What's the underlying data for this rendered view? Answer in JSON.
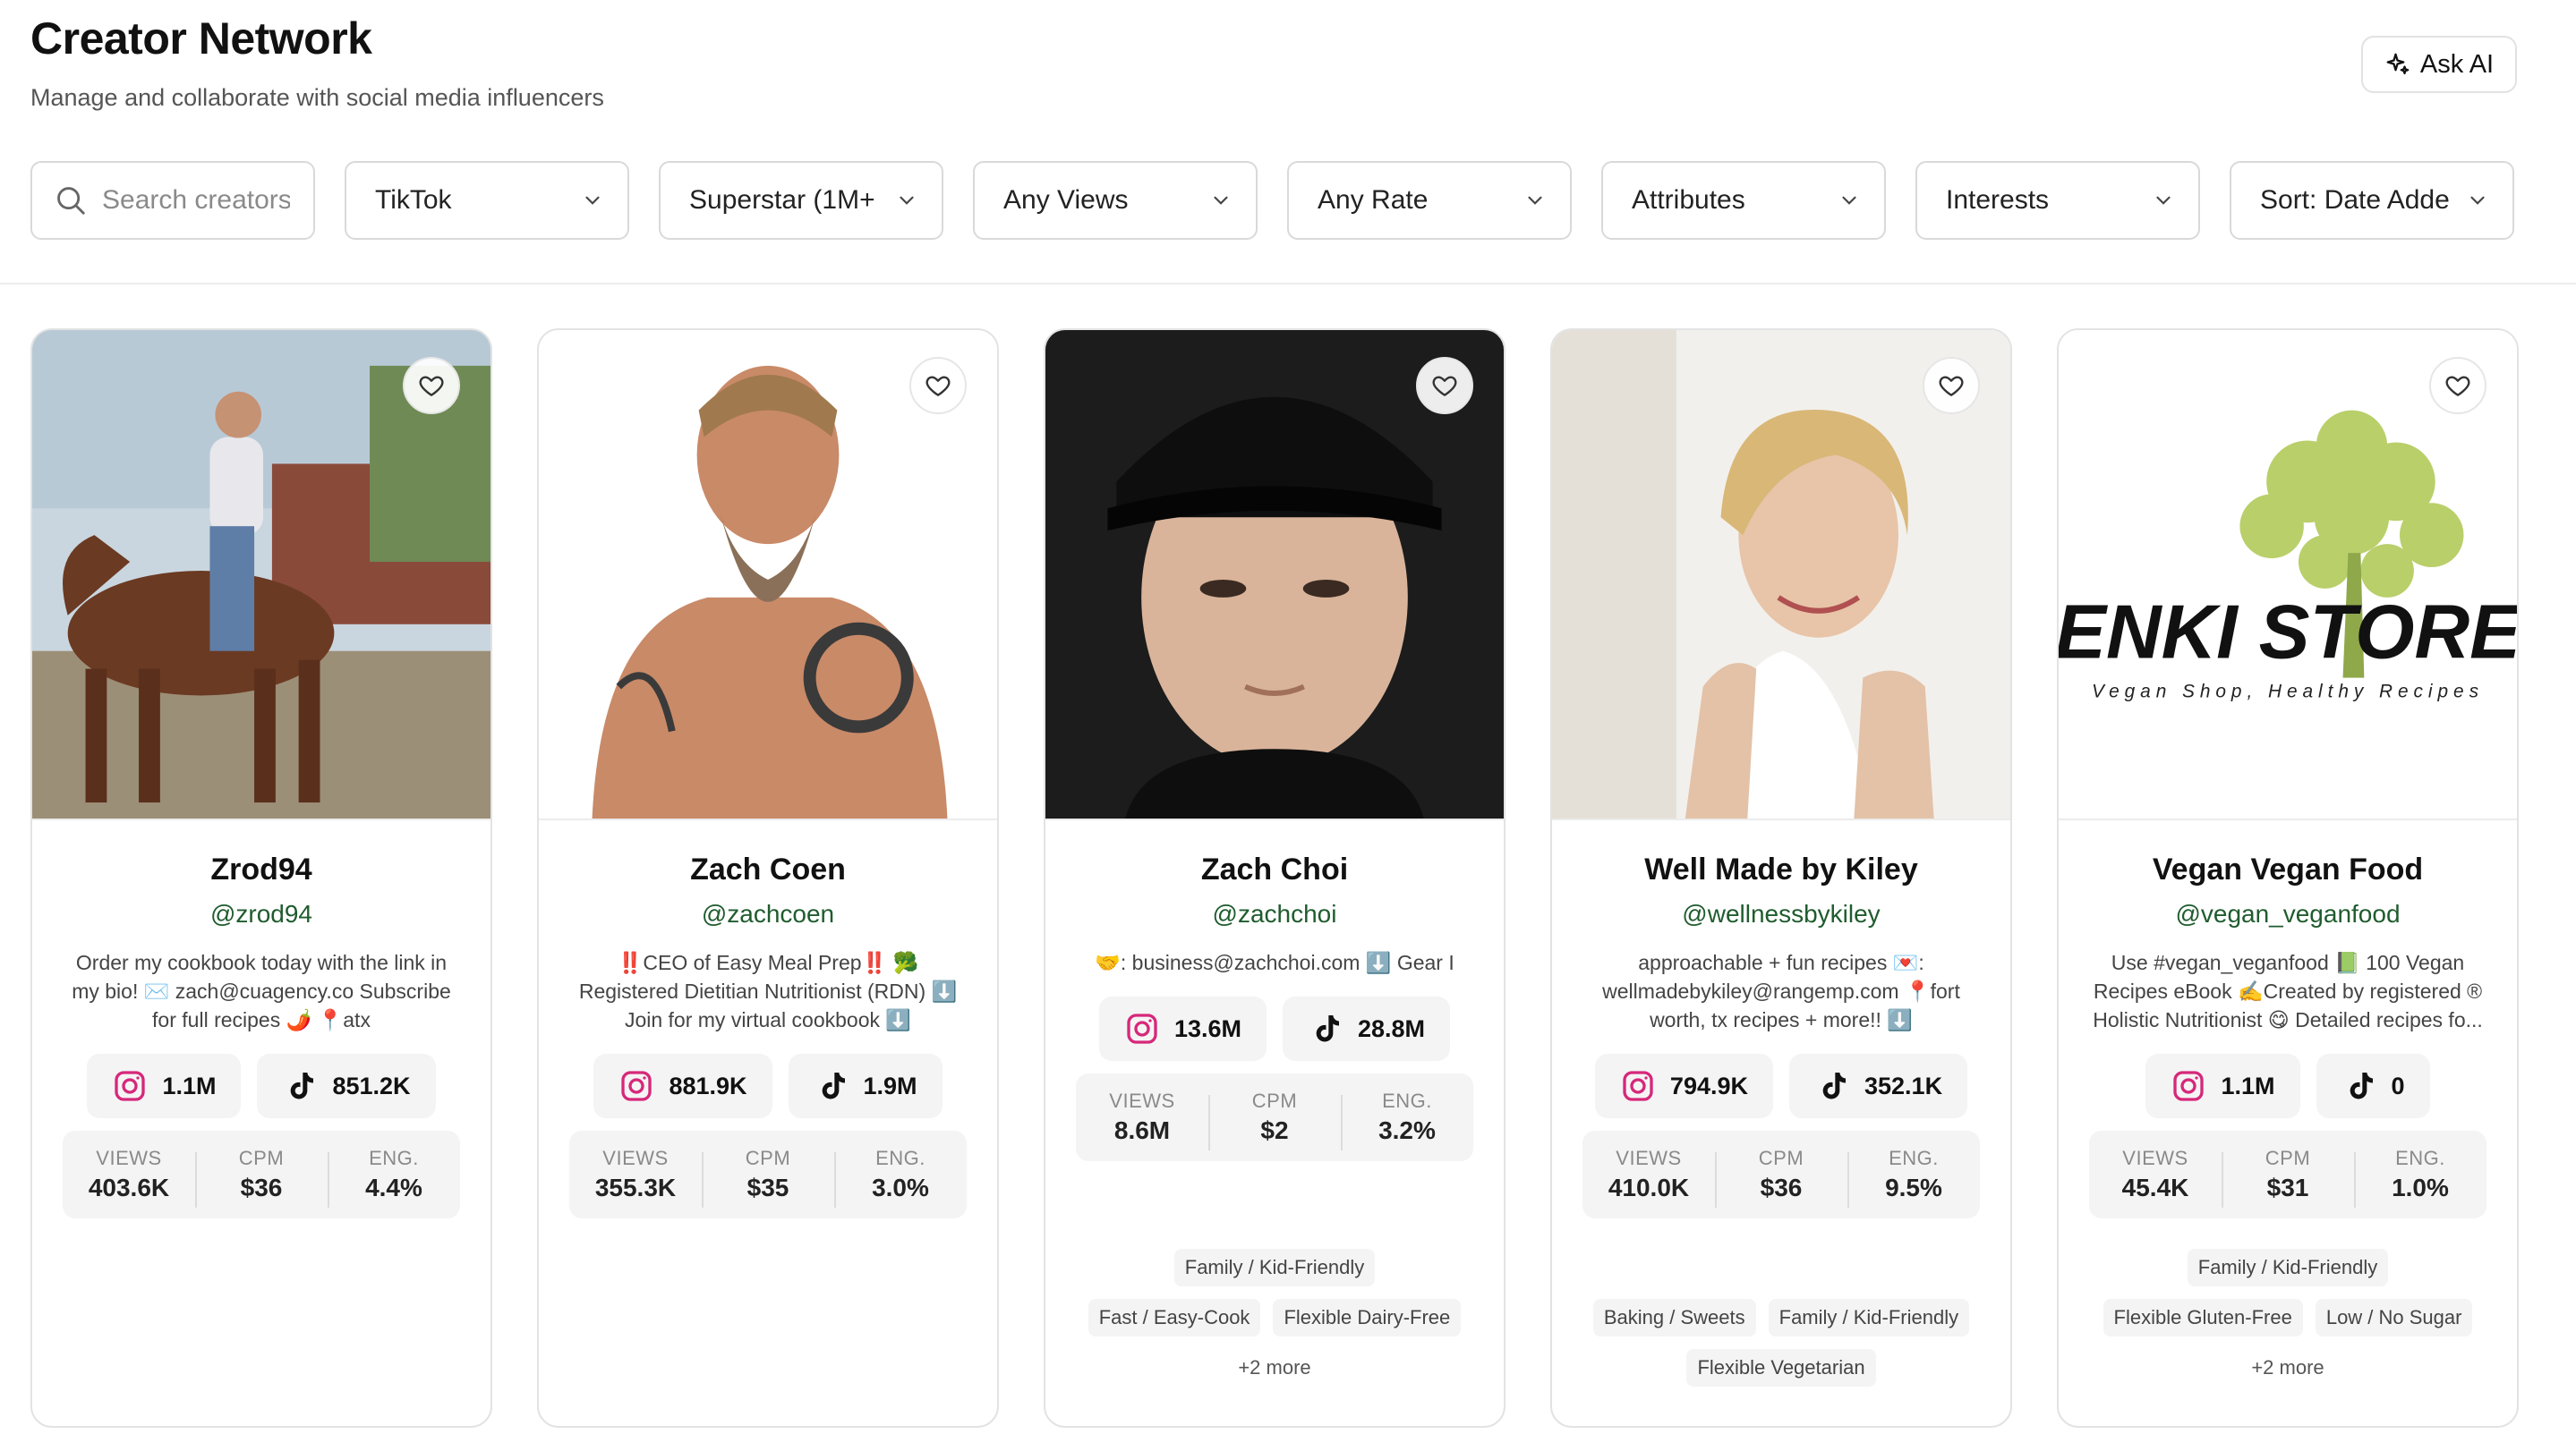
{
  "header": {
    "title": "Creator Network",
    "subtitle": "Manage and collaborate with social media influencers",
    "ask_ai_label": "Ask AI"
  },
  "filters": {
    "search_placeholder": "Search creators",
    "platform": "TikTok",
    "tier": "Superstar (1M+",
    "views": "Any Views",
    "rate": "Any Rate",
    "attributes": "Attributes",
    "interests": "Interests",
    "sort": "Sort: Date Adde"
  },
  "stat_labels": {
    "views": "VIEWS",
    "cpm": "CPM",
    "eng": "ENG."
  },
  "creators": [
    {
      "name": "Zrod94",
      "handle": "@zrod94",
      "bio": "Order my cookbook today with the link in my bio! ✉️ zach@cuagency.co Subscribe for full recipes 🌶️ 📍atx",
      "instagram": "1.1M",
      "tiktok": "851.2K",
      "views": "403.6K",
      "cpm": "$36",
      "eng": "4.4%",
      "tags": []
    },
    {
      "name": "Zach Coen",
      "handle": "@zachcoen",
      "bio": "‼️CEO of Easy Meal Prep‼️ 🥦 Registered Dietitian Nutritionist (RDN) ⬇️ Join for my virtual cookbook ⬇️",
      "instagram": "881.9K",
      "tiktok": "1.9M",
      "views": "355.3K",
      "cpm": "$35",
      "eng": "3.0%",
      "tags": []
    },
    {
      "name": "Zach Choi",
      "handle": "@zachchoi",
      "bio": "🤝: business@zachchoi.com ⬇️ Gear I use:",
      "instagram": "13.6M",
      "tiktok": "28.8M",
      "views": "8.6M",
      "cpm": "$2",
      "eng": "3.2%",
      "tags": [
        "Family / Kid-Friendly",
        "Fast / Easy-Cook",
        "Flexible Dairy-Free"
      ],
      "more": "+2 more"
    },
    {
      "name": "Well Made by Kiley",
      "handle": "@wellnessbykiley",
      "bio": "approachable + fun recipes 💌: wellmadebykiley@rangemp.com 📍fort worth, tx recipes + more!! ⬇️",
      "instagram": "794.9K",
      "tiktok": "352.1K",
      "views": "410.0K",
      "cpm": "$36",
      "eng": "9.5%",
      "tags": [
        "Baking / Sweets",
        "Family / Kid-Friendly",
        "Flexible Vegetarian"
      ]
    },
    {
      "name": "Vegan Vegan Food",
      "handle": "@vegan_veganfood",
      "bio": "Use #vegan_veganfood 📗 100 Vegan Recipes eBook ✍️Created by registered ® Holistic Nutritionist 😋 Detailed recipes fo...",
      "instagram": "1.1M",
      "tiktok": "0",
      "views": "45.4K",
      "cpm": "$31",
      "eng": "1.0%",
      "tags": [
        "Family / Kid-Friendly",
        "Flexible Gluten-Free",
        "Low / No Sugar"
      ],
      "more": "+2 more",
      "logo_text": "ENKI STORE",
      "logo_tagline": "Vegan Shop, Healthy Recipes"
    }
  ]
}
